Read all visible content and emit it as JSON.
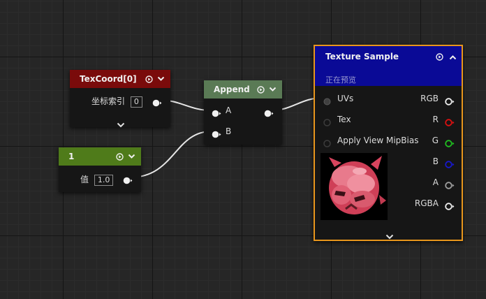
{
  "texcoord": {
    "title": "TexCoord[0]",
    "param_label": "坐标索引",
    "param_value": "0"
  },
  "constant": {
    "title": "1",
    "param_label": "值",
    "param_value": "1.0"
  },
  "append": {
    "title": "Append",
    "input_a": "A",
    "input_b": "B"
  },
  "texture_sample": {
    "title": "Texture Sample",
    "subtitle": "正在预览",
    "inputs": [
      "UVs",
      "Tex",
      "Apply View MipBias"
    ],
    "outputs": [
      "RGB",
      "R",
      "G",
      "B",
      "A",
      "RGBA"
    ]
  },
  "colors": {
    "texcoord_header": "#7a0b0b",
    "constant_header": "#4f7b1a",
    "append_header": "#5a7a55",
    "texture_header": "#0a0a96",
    "selection_border": "#e8961c",
    "pin_r": "#e01010",
    "pin_g": "#20c020",
    "pin_b": "#1818d0"
  },
  "icons": [
    "preview-play-icon",
    "collapse-chevron-icon",
    "expand-chevron-icon",
    "texture-preview-thumbnail"
  ]
}
